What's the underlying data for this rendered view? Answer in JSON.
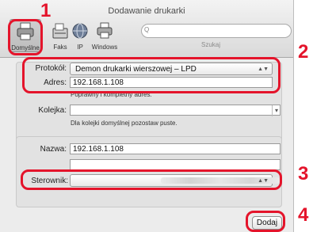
{
  "window": {
    "title": "Dodawanie drukarki"
  },
  "toolbar": {
    "items": [
      {
        "label": "Domyślne",
        "icon": "printer-default-icon",
        "active": true
      },
      {
        "label": "Faks",
        "icon": "fax-icon"
      },
      {
        "label": "IP",
        "icon": "globe-ip-icon"
      },
      {
        "label": "Windows",
        "icon": "windows-printer-icon"
      }
    ],
    "search": {
      "placeholder": "Q",
      "label": "Szukaj"
    }
  },
  "form": {
    "protocol": {
      "label": "Protokół:",
      "value": "Demon drukarki wierszowej – LPD"
    },
    "address": {
      "label": "Adres:",
      "value": "192.168.1.108",
      "hint": "Poprawny i kompletny adres."
    },
    "queue": {
      "label": "Kolejka:",
      "value": "",
      "hint": "Dla kolejki domyślnej pozostaw puste."
    },
    "name": {
      "label": "Nazwa:",
      "value": "192.168.1.108"
    },
    "location": {
      "label": "",
      "value": ""
    },
    "driver": {
      "label": "Sterownik:",
      "value": ""
    }
  },
  "buttons": {
    "add": "Dodaj"
  },
  "callouts": [
    "1",
    "2",
    "3",
    "4"
  ],
  "colors": {
    "callout": "#e4142b"
  }
}
